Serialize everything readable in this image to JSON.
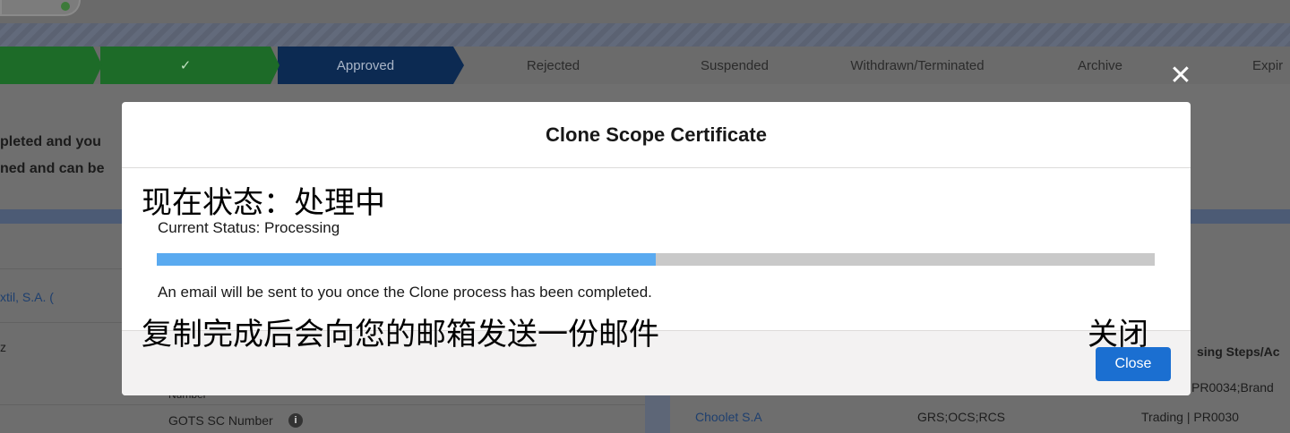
{
  "path": {
    "stages": [
      {
        "label": ""
      },
      {
        "label": "✓"
      },
      {
        "label": "Approved"
      },
      {
        "label": "Rejected"
      },
      {
        "label": "Suspended"
      },
      {
        "label": "Withdrawn/Terminated"
      },
      {
        "label": "Archive"
      },
      {
        "label": "Expir"
      }
    ]
  },
  "background": {
    "side_line1": "pleted and you",
    "side_line2": "ned and can be",
    "left_link": "xtil, S.A. (",
    "left_z": "z",
    "left_number": "Number",
    "gots_label": "GOTS SC Number",
    "right_header": "sing Steps/Ac",
    "right_row1": "PR0034;Brand",
    "company": "Choolet S.A",
    "standards": "GRS;OCS;RCS",
    "trading": "Trading | PR0030"
  },
  "modal": {
    "title": "Clone Scope Certificate",
    "annotation_status": "现在状态：处理中",
    "status": "Current Status: Processing",
    "progress_fraction": 0.5,
    "info": "An email will be sent to you once the Clone process has been completed.",
    "annotation_info": "复制完成后会向您的邮箱发送一份邮件",
    "annotation_close": "关闭",
    "close_label": "Close"
  },
  "colors": {
    "progress_fill": "#5aaaf0",
    "close_button": "#1b6fd1"
  }
}
